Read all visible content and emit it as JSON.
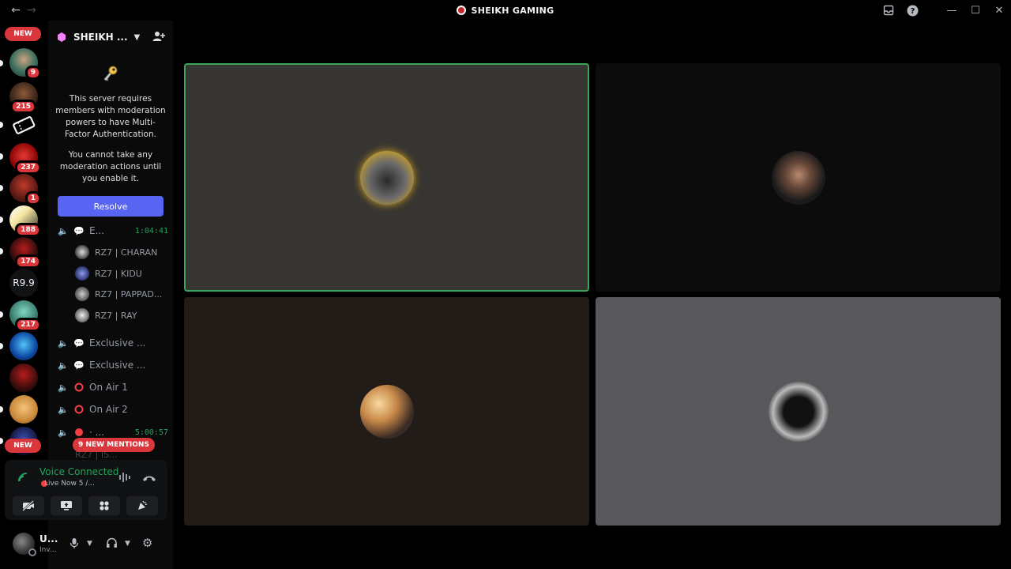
{
  "titlebar": {
    "back_icon": "arrow-left-icon",
    "forward_icon": "arrow-right-icon",
    "server_title": "SHEIKH GAMING",
    "right_icons": [
      "inbox-icon",
      "help-icon",
      "minimize-icon",
      "maximize-icon",
      "close-icon"
    ]
  },
  "rail": {
    "top_badge": "NEW",
    "bottom_badge": "NEW",
    "guilds": [
      {
        "badge": "9"
      },
      {
        "badge": "215"
      },
      {
        "badge": ""
      },
      {
        "badge": "237"
      },
      {
        "badge": "1"
      },
      {
        "badge": "188"
      },
      {
        "badge": "174"
      },
      {
        "badge": "",
        "label": "R9.9"
      },
      {
        "badge": "217"
      },
      {
        "badge": ""
      },
      {
        "badge": ""
      },
      {
        "badge": ""
      }
    ]
  },
  "sidebar": {
    "server_name": "SHEIKH ...",
    "mfa_notice": {
      "line1": "This server requires members with moderation powers to have Multi-Factor Authentication.",
      "line2": "You cannot take any moderation actions until you enable it.",
      "resolve_label": "Resolve"
    },
    "active_channel": {
      "name": "E...",
      "time": "1:04:41"
    },
    "members": [
      {
        "name": "RZ7 | CHARAN"
      },
      {
        "name": "RZ7 | KIDU"
      },
      {
        "name": "RZ7 | PAPPAD..."
      },
      {
        "name": "RZ7 | RAY"
      }
    ],
    "channels": [
      {
        "name": "Exclusive ..."
      },
      {
        "name": "Exclusive ..."
      },
      {
        "name": "On Air 1"
      },
      {
        "name": "On Air 2"
      }
    ],
    "last_channel": {
      "name": "· ...",
      "time": "5:00:57"
    },
    "hidden_member": "RZ7 | IS...",
    "mentions_label": "9 NEW MENTIONS"
  },
  "voice_panel": {
    "status": "Voice Connected",
    "subtitle": "Live Now 5 /..."
  },
  "user_panel": {
    "name": "U...",
    "status": "Inv..."
  }
}
